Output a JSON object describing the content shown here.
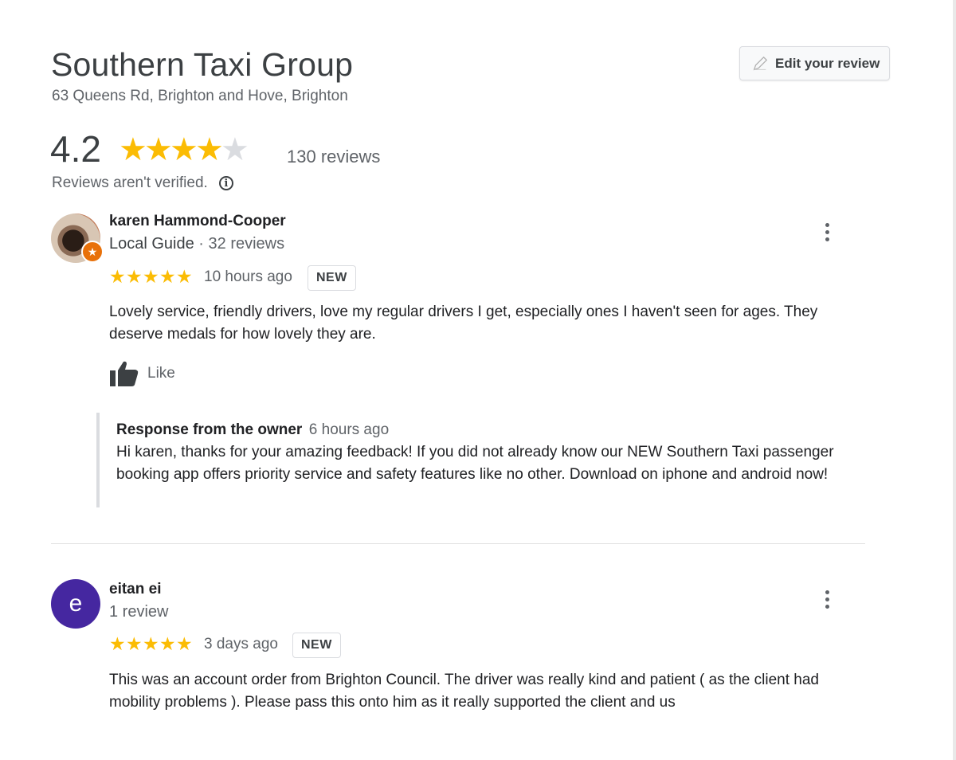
{
  "business": {
    "name": "Southern Taxi Group",
    "address": "63 Queens Rd, Brighton and Hove, Brighton"
  },
  "edit_button": {
    "label": "Edit your review",
    "icon": "pencil-icon"
  },
  "rating": {
    "value": "4.2",
    "stars_filled": 4,
    "stars_total": 5,
    "review_count": "130 reviews",
    "not_verified": "Reviews aren't verified.",
    "info_icon": "info-icon",
    "star_color": "#fbbc04",
    "star_empty_color": "#dadce0"
  },
  "reviews": [
    {
      "author": "karen Hammond-Cooper",
      "guide_label": "Local Guide",
      "separator": " · ",
      "review_count": "32 reviews",
      "stars": 5,
      "time": "10 hours ago",
      "badge": "NEW",
      "text": "Lovely service, friendly drivers, love my regular drivers I get, especially ones I haven't seen for ages. They deserve medals for how lovely they are.",
      "like_label": "Like",
      "owner_response": {
        "label": "Response from the owner",
        "time": "6 hours ago",
        "text": "Hi karen, thanks for your amazing feedback! If you did not already know our NEW Southern Taxi passenger booking app offers priority service and safety features like no other. Download on iphone and android now!"
      }
    },
    {
      "author": "eitan ei",
      "avatar_letter": "e",
      "avatar_color": "#4527a0",
      "review_count": "1 review",
      "stars": 5,
      "time": "3 days ago",
      "badge": "NEW",
      "text": "This was an account order from Brighton Council. The driver was really kind and patient ( as the client had mobility problems ). Please pass this onto him as it really supported the client and us"
    }
  ]
}
